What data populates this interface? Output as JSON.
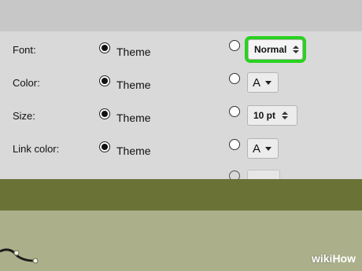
{
  "rows": [
    {
      "label": "Font:",
      "option": "Theme",
      "control": {
        "kind": "select",
        "value": "Normal",
        "highlighted": true
      }
    },
    {
      "label": "Color:",
      "option": "Theme",
      "control": {
        "kind": "color",
        "value": "A"
      }
    },
    {
      "label": "Size:",
      "option": "Theme",
      "control": {
        "kind": "select",
        "value": "10 pt"
      }
    },
    {
      "label": "Link color:",
      "option": "Theme",
      "control": {
        "kind": "color",
        "value": "A"
      }
    }
  ],
  "watermark": {
    "brand": "wiki",
    "suffix": "How"
  },
  "colors": {
    "highlight": "#28d21e",
    "band": "#6b7236",
    "panel": "#d9d9d9"
  }
}
